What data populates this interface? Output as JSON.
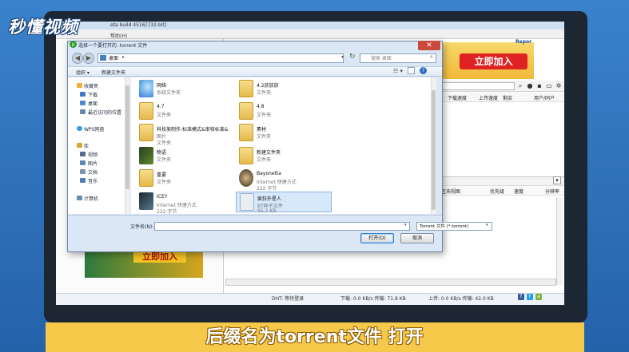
{
  "brand": {
    "text": "秒懂视频"
  },
  "app": {
    "title": "eta build 4516] [32-bit]",
    "menu_help": "帮助(H)",
    "ad_top": {
      "brand": "Repor",
      "button": "立即加入"
    },
    "list_columns": [
      "下载速度",
      "上传速度",
      "剩余",
      "用户/同户"
    ],
    "pane2_columns": [
      "区块视图",
      "优先级",
      "速度",
      "分辨率"
    ],
    "ad_bottom": {
      "button": "立即加入"
    },
    "status": {
      "dht": "DHT: 等待登录",
      "download": "下载: 0.0 KB/s 传输: 71.8 KB",
      "upload": "上传: 0.0 KB/s 传输: 42.0 KB"
    }
  },
  "dialog": {
    "title": "选择一个要打开的 .torrent 文件",
    "address": {
      "location": "桌面",
      "separator": "▸"
    },
    "search_placeholder": "搜索 桌面",
    "commands": {
      "organize": "组织 ▾",
      "new_folder": "新建文件夹"
    },
    "nav": [
      {
        "label": "收藏夹",
        "kind": "header"
      },
      {
        "label": "下载",
        "kind": "item"
      },
      {
        "label": "桌面",
        "kind": "item"
      },
      {
        "label": "最近访问的位置",
        "kind": "item"
      },
      {
        "label": "WPS网盘",
        "kind": "header"
      },
      {
        "label": "库",
        "kind": "header"
      },
      {
        "label": "视频",
        "kind": "item"
      },
      {
        "label": "图片",
        "kind": "item"
      },
      {
        "label": "文档",
        "kind": "item"
      },
      {
        "label": "音乐",
        "kind": "item"
      },
      {
        "label": "计算机",
        "kind": "header"
      }
    ],
    "files": [
      {
        "name": "网络",
        "line2": "系统文件夹",
        "line3": ""
      },
      {
        "name": "4.2放放放",
        "line2": "文件夹",
        "line3": ""
      },
      {
        "name": "4.7",
        "line2": "文件夹",
        "line3": ""
      },
      {
        "name": "4.8",
        "line2": "文件夹",
        "line3": ""
      },
      {
        "name": "科技美制作:标准模式&审核标准&",
        "line2": "文件夹",
        "line3": "图片"
      },
      {
        "name": "素材",
        "line2": "文件夹",
        "line3": ""
      },
      {
        "name": "物语",
        "line2": "文件夹",
        "line3": ""
      },
      {
        "name": "新建文件夹",
        "line2": "文件夹",
        "line3": ""
      },
      {
        "name": "重要",
        "line2": "文件夹",
        "line3": ""
      },
      {
        "name": "Bayonetta",
        "line2": "Internet 快捷方式",
        "line3": "222 字节"
      },
      {
        "name": "ICEY",
        "line2": "Internet 快捷方式",
        "line3": "222 字节"
      },
      {
        "name": "疯狂外星人",
        "line2": "BT种子文件",
        "line3": "95.2 KB"
      }
    ],
    "filename_label": "文件名(N):",
    "filename_value": "",
    "filetype": "Torrent 文件 (*.torrent)",
    "open_button": "打开(O)",
    "cancel_button": "取消"
  },
  "caption": "后缀名为torrent文件 打开",
  "colors": {
    "accent": "#3a7fd0",
    "caption_bg": "#f6c94a",
    "frame": "#2b6fb8"
  }
}
